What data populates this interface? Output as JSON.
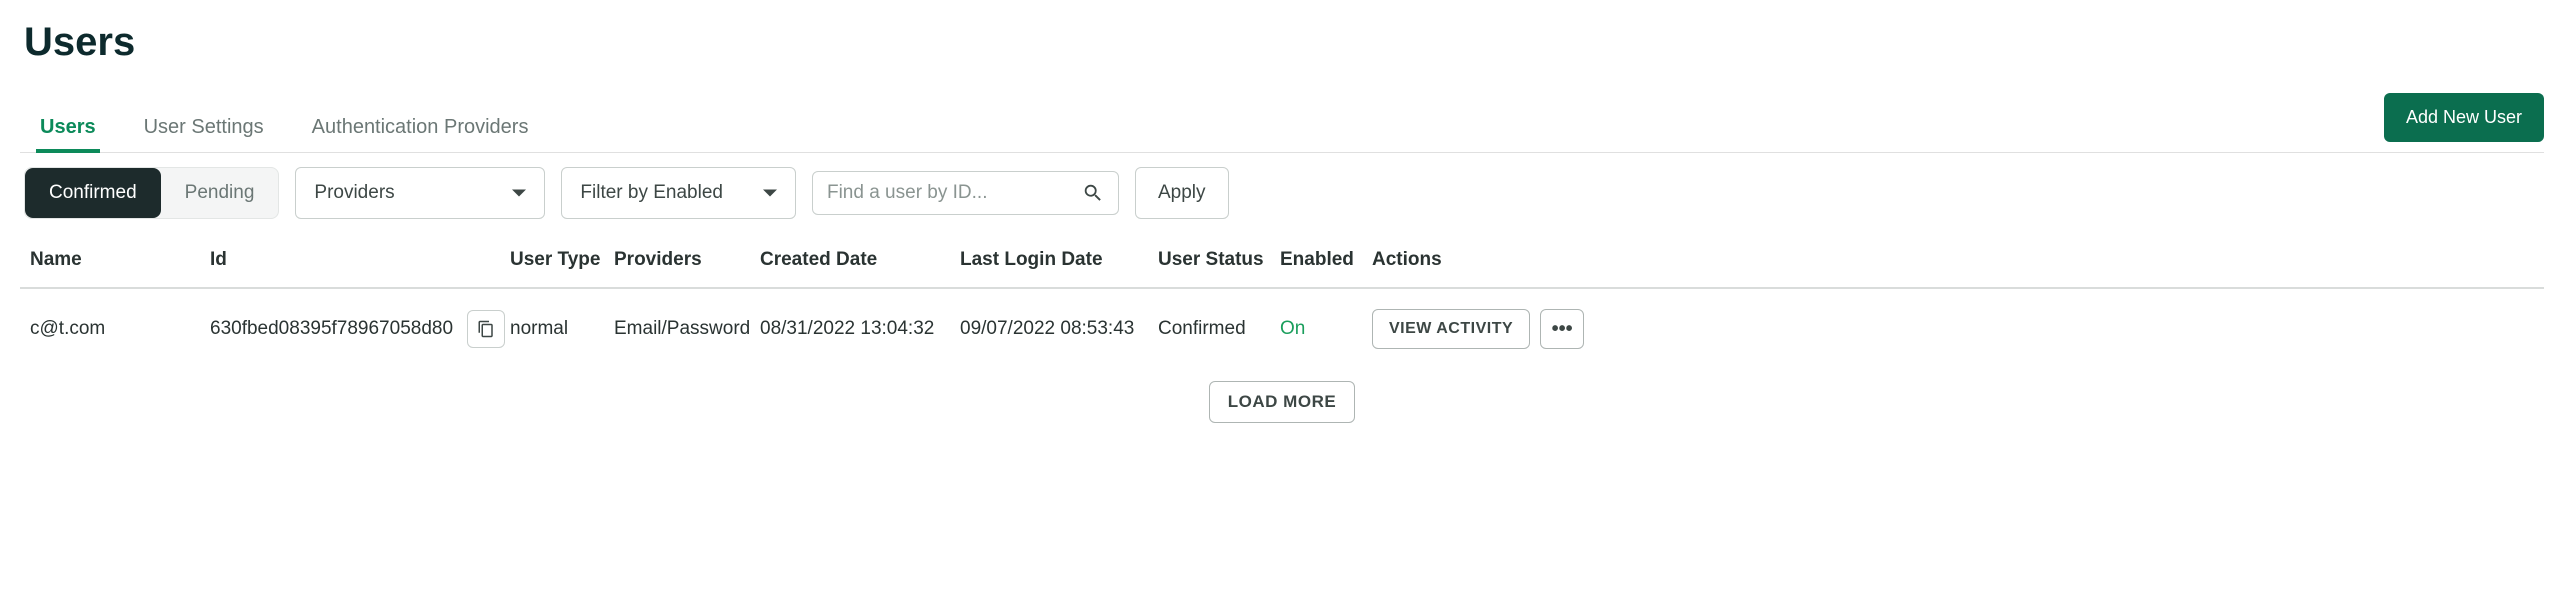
{
  "page": {
    "title": "Users"
  },
  "tabs": {
    "users": "Users",
    "user_settings": "User Settings",
    "auth_providers": "Authentication Providers"
  },
  "buttons": {
    "add_new_user": "Add New User",
    "apply": "Apply",
    "view_activity": "VIEW ACTIVITY",
    "load_more": "LOAD MORE",
    "more": "•••"
  },
  "filter": {
    "segmented": {
      "confirmed": "Confirmed",
      "pending": "Pending"
    },
    "providers_select": "Providers",
    "enabled_select": "Filter by Enabled",
    "search_placeholder": "Find a user by ID..."
  },
  "table": {
    "headers": {
      "name": "Name",
      "id": "Id",
      "user_type": "User Type",
      "providers": "Providers",
      "created_date": "Created Date",
      "last_login_date": "Last Login Date",
      "user_status": "User Status",
      "enabled": "Enabled",
      "actions": "Actions"
    },
    "rows": [
      {
        "name": "c@t.com",
        "id": "630fbed08395f78967058d80",
        "user_type": "normal",
        "providers": "Email/Password",
        "created_date": "08/31/2022 13:04:32",
        "last_login_date": "09/07/2022 08:53:43",
        "user_status": "Confirmed",
        "enabled": "On"
      }
    ]
  }
}
